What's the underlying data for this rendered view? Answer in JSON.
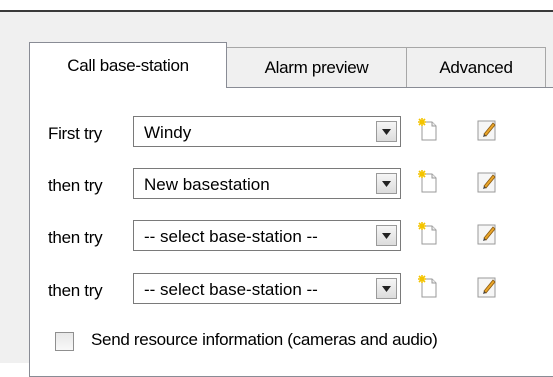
{
  "tabs": [
    {
      "label": "Call base-station",
      "active": true
    },
    {
      "label": "Alarm preview",
      "active": false
    },
    {
      "label": "Advanced",
      "active": false
    }
  ],
  "rows": [
    {
      "label": "First try",
      "value": "Windy"
    },
    {
      "label": "then try",
      "value": "New basestation"
    },
    {
      "label": "then try",
      "value": "-- select base-station --"
    },
    {
      "label": "then try",
      "value": "-- select base-station --"
    }
  ],
  "icons": {
    "dropdown": "chevron-down-icon",
    "new": "new-document-icon",
    "edit": "pencil-edit-icon"
  },
  "send_resource": {
    "label": "Send resource information (cameras and audio)",
    "checked": false
  },
  "colors": {
    "dialog_bg": "#f0f0f0",
    "panel_bg": "#ffffff",
    "border": "#898c95"
  }
}
